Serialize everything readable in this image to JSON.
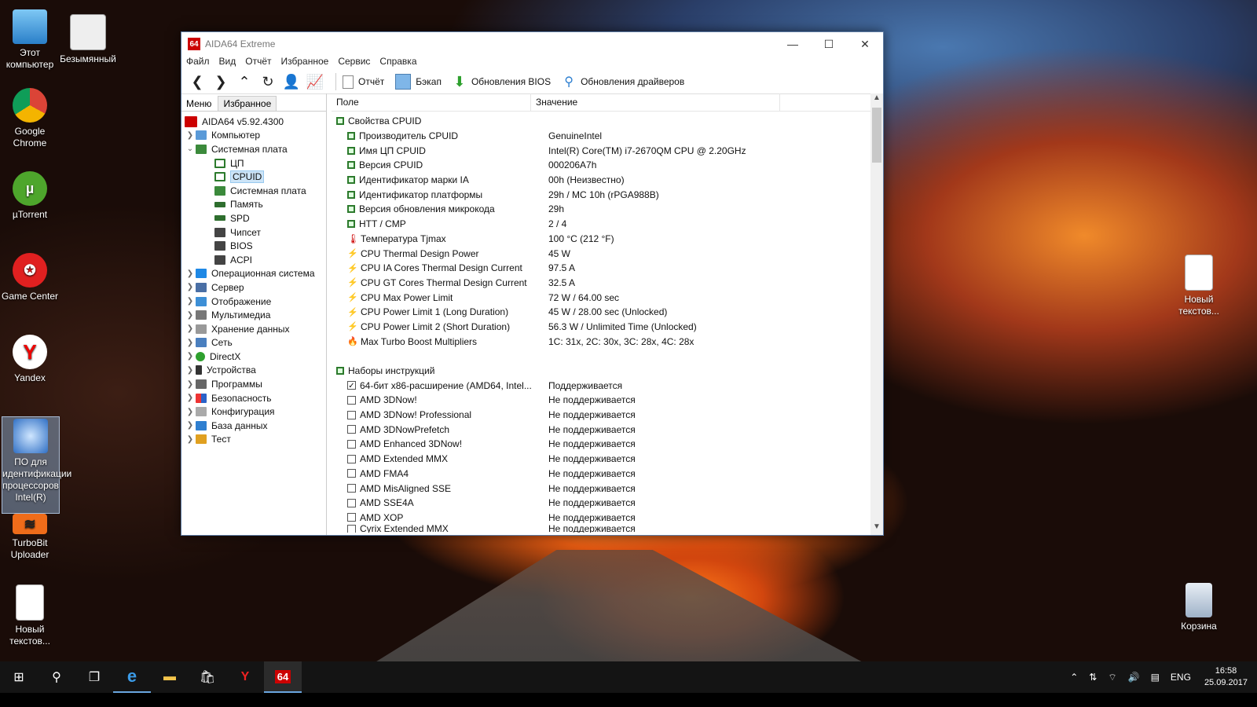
{
  "desktop": {
    "icons": [
      {
        "label": "Этот компьютер"
      },
      {
        "label": "Безымянный"
      },
      {
        "label": "Google Chrome"
      },
      {
        "label": "µTorrent"
      },
      {
        "label": "Game Center"
      },
      {
        "label": "Yandex"
      },
      {
        "label": "ПО для идентификации процессоров Intel(R)"
      },
      {
        "label": "TurboBit Uploader"
      },
      {
        "label": "Новый текстов..."
      },
      {
        "label": "Новый текстов..."
      },
      {
        "label": "Корзина"
      }
    ]
  },
  "window": {
    "title": "AIDA64 Extreme",
    "app_icon": "64",
    "menu": [
      "Файл",
      "Вид",
      "Отчёт",
      "Избранное",
      "Сервис",
      "Справка"
    ],
    "toolbar": {
      "report": "Отчёт",
      "backup": "Бэкап",
      "bios_update": "Обновления BIOS",
      "driver_update": "Обновления драйверов"
    },
    "left_tabs": {
      "menu": "Меню",
      "favorites": "Избранное"
    },
    "tree": [
      {
        "label": "AIDA64 v5.92.4300"
      },
      {
        "label": "Компьютер"
      },
      {
        "label": "Системная плата"
      },
      {
        "label": "ЦП"
      },
      {
        "label": "CPUID"
      },
      {
        "label": "Системная плата"
      },
      {
        "label": "Память"
      },
      {
        "label": "SPD"
      },
      {
        "label": "Чипсет"
      },
      {
        "label": "BIOS"
      },
      {
        "label": "ACPI"
      },
      {
        "label": "Операционная система"
      },
      {
        "label": "Сервер"
      },
      {
        "label": "Отображение"
      },
      {
        "label": "Мультимедиа"
      },
      {
        "label": "Хранение данных"
      },
      {
        "label": "Сеть"
      },
      {
        "label": "DirectX"
      },
      {
        "label": "Устройства"
      },
      {
        "label": "Программы"
      },
      {
        "label": "Безопасность"
      },
      {
        "label": "Конфигурация"
      },
      {
        "label": "База данных"
      },
      {
        "label": "Тест"
      }
    ],
    "columns": {
      "field": "Поле",
      "value": "Значение"
    },
    "rows": [
      {
        "field": "Свойства CPUID",
        "value": ""
      },
      {
        "field": "Производитель CPUID",
        "value": "GenuineIntel"
      },
      {
        "field": "Имя ЦП CPUID",
        "value": "Intel(R) Core(TM) i7-2670QM CPU @ 2.20GHz"
      },
      {
        "field": "Версия CPUID",
        "value": "000206A7h"
      },
      {
        "field": "Идентификатор марки IA",
        "value": "00h  (Неизвестно)"
      },
      {
        "field": "Идентификатор платформы",
        "value": "29h / MC 10h  (rPGA988B)"
      },
      {
        "field": "Версия обновления микрокода",
        "value": "29h"
      },
      {
        "field": "HTT / CMP",
        "value": "2 / 4"
      },
      {
        "field": "Температура Tjmax",
        "value": "100 °C  (212 °F)"
      },
      {
        "field": "CPU Thermal Design Power",
        "value": "45 W"
      },
      {
        "field": "CPU IA Cores Thermal Design Current",
        "value": "97.5 A"
      },
      {
        "field": "CPU GT Cores Thermal Design Current",
        "value": "32.5 A"
      },
      {
        "field": "CPU Max Power Limit",
        "value": "72 W / 64.00 sec"
      },
      {
        "field": "CPU Power Limit 1 (Long Duration)",
        "value": "45 W / 28.00 sec  (Unlocked)"
      },
      {
        "field": "CPU Power Limit 2 (Short Duration)",
        "value": "56.3 W / Unlimited Time  (Unlocked)"
      },
      {
        "field": "Max Turbo Boost Multipliers",
        "value": "1C: 31x, 2C: 30x, 3C: 28x, 4C: 28x"
      },
      {
        "field": "",
        "value": ""
      },
      {
        "field": "Наборы инструкций",
        "value": ""
      },
      {
        "field": "64-бит x86-расширение (AMD64, Intel...",
        "value": "Поддерживается",
        "checked": "✓"
      },
      {
        "field": "AMD 3DNow!",
        "value": "Не поддерживается"
      },
      {
        "field": "AMD 3DNow! Professional",
        "value": "Не поддерживается"
      },
      {
        "field": "AMD 3DNowPrefetch",
        "value": "Не поддерживается"
      },
      {
        "field": "AMD Enhanced 3DNow!",
        "value": "Не поддерживается"
      },
      {
        "field": "AMD Extended MMX",
        "value": "Не поддерживается"
      },
      {
        "field": "AMD FMA4",
        "value": "Не поддерживается"
      },
      {
        "field": "AMD MisAligned SSE",
        "value": "Не поддерживается"
      },
      {
        "field": "AMD SSE4A",
        "value": "Не поддерживается"
      },
      {
        "field": "AMD XOP",
        "value": "Не поддерживается"
      },
      {
        "field": "Cyrix Extended MMX",
        "value": "Не поддерживается"
      }
    ]
  },
  "taskbar": {
    "lang": "ENG",
    "time": "16:58",
    "date": "25.09.2017"
  },
  "colors": {
    "accent": "#c00000",
    "taskbar": "#141414",
    "selection": "#cce4f7"
  }
}
